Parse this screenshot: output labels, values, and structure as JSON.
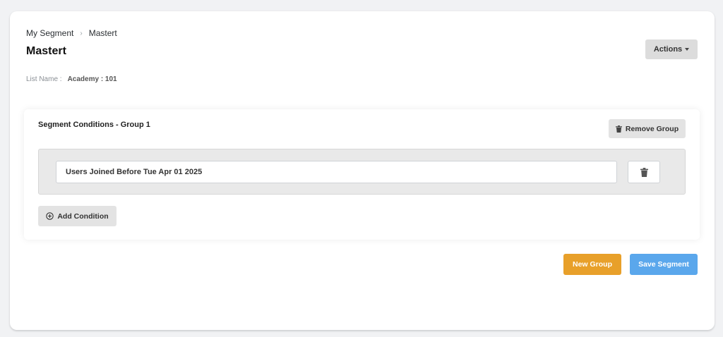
{
  "breadcrumb": {
    "items": [
      "My Segment",
      "Mastert"
    ],
    "separator": "›"
  },
  "page": {
    "title": "Mastert"
  },
  "header": {
    "actions_label": "Actions"
  },
  "list_info": {
    "label": "List Name :",
    "value": "Academy : 101"
  },
  "group": {
    "title": "Segment Conditions - Group 1",
    "remove_label": "Remove Group",
    "conditions": [
      {
        "text": "Users Joined Before Tue Apr 01 2025"
      }
    ],
    "add_condition_label": "Add Condition"
  },
  "footer": {
    "new_group_label": "New Group",
    "save_segment_label": "Save Segment"
  },
  "colors": {
    "new_group_bg": "#e8a02a",
    "save_segment_bg": "#5aa7ec",
    "neutral_button_bg": "#e3e3e3"
  },
  "icons": {
    "breadcrumb_separator": "chevron-right-icon",
    "actions_caret": "caret-down-icon",
    "remove_group": "trash-icon",
    "delete_condition": "trash-icon",
    "add_condition": "plus-circle-icon"
  }
}
